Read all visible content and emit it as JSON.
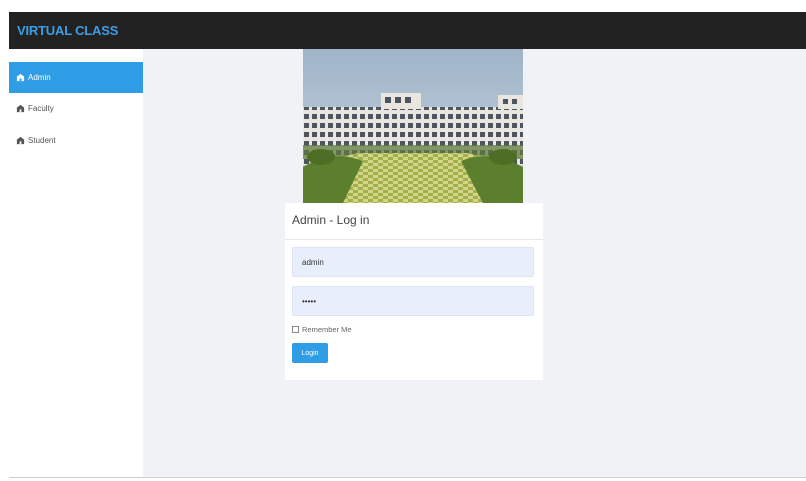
{
  "app": {
    "brand": "VIRTUAL CLASS"
  },
  "sidebar": {
    "items": [
      {
        "label": "Admin",
        "icon": "building-icon",
        "active": true
      },
      {
        "label": "Faculty",
        "icon": "building-icon",
        "active": false
      },
      {
        "label": "Student",
        "icon": "building-icon",
        "active": false
      }
    ]
  },
  "login": {
    "title": "Admin - Log in",
    "username_value": "admin",
    "password_value": "•••••",
    "remember_label": "Remember Me",
    "login_button": "Login"
  },
  "colors": {
    "topbar": "#222222",
    "brand_text": "#3c9ee4",
    "accent": "#2f9de6",
    "content_bg": "#f0f2f5",
    "input_bg": "#e8eefb"
  }
}
